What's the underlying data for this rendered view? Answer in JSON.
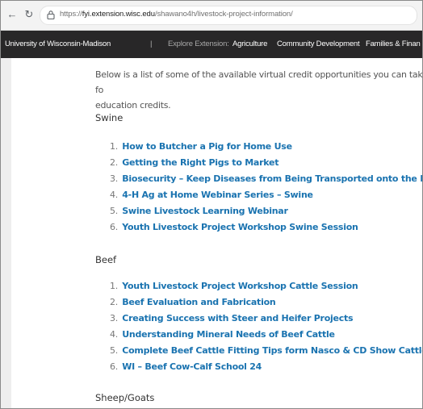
{
  "browser": {
    "back_icon": "back-arrow-icon",
    "reload_icon": "reload-icon",
    "url_scheme": "https://",
    "url_host": "fyi.extension.wisc.edu",
    "url_path": "/shawano4h/livestock-project-information/"
  },
  "site_nav": {
    "university": "University of Wisconsin-Madison",
    "separator": "|",
    "explore_label": "Explore Extension:",
    "items": [
      "Agriculture",
      "Community Development",
      "Families & Finan"
    ]
  },
  "intro": "Below is a list of some of the available virtual credit opportunities you can take fo\neducation credits.",
  "sections": [
    {
      "heading": "Swine",
      "links": [
        {
          "num": "1.",
          "label": "How to Butcher a Pig for Home Use"
        },
        {
          "num": "2.",
          "label": "Getting the Right Pigs to Market"
        },
        {
          "num": "3.",
          "label": "Biosecurity – Keep Diseases from Being Transported onto the Farm"
        },
        {
          "num": "4.",
          "label": "4-H Ag at Home Webinar Series – Swine"
        },
        {
          "num": "5.",
          "label": "Swine Livestock Learning Webinar"
        },
        {
          "num": "6.",
          "label": "Youth Livestock Project Workshop Swine Session"
        }
      ]
    },
    {
      "heading": "Beef",
      "links": [
        {
          "num": "1.",
          "label": "Youth Livestock Project Workshop Cattle Session"
        },
        {
          "num": "2.",
          "label": "Beef Evaluation and Fabrication"
        },
        {
          "num": "3.",
          "label": "Creating Success with Steer and Heifer Projects"
        },
        {
          "num": "4.",
          "label": "Understanding Mineral Needs of Beef Cattle"
        },
        {
          "num": "5.",
          "label": "Complete Beef Cattle Fitting Tips form Nasco & CD Show Cattle"
        },
        {
          "num": "6.",
          "label": "WI – Beef Cow-Calf School 24"
        }
      ]
    },
    {
      "heading": "Sheep/Goats"
    }
  ],
  "colors": {
    "link": "#1a73b0",
    "nav_bg": "#282728"
  }
}
